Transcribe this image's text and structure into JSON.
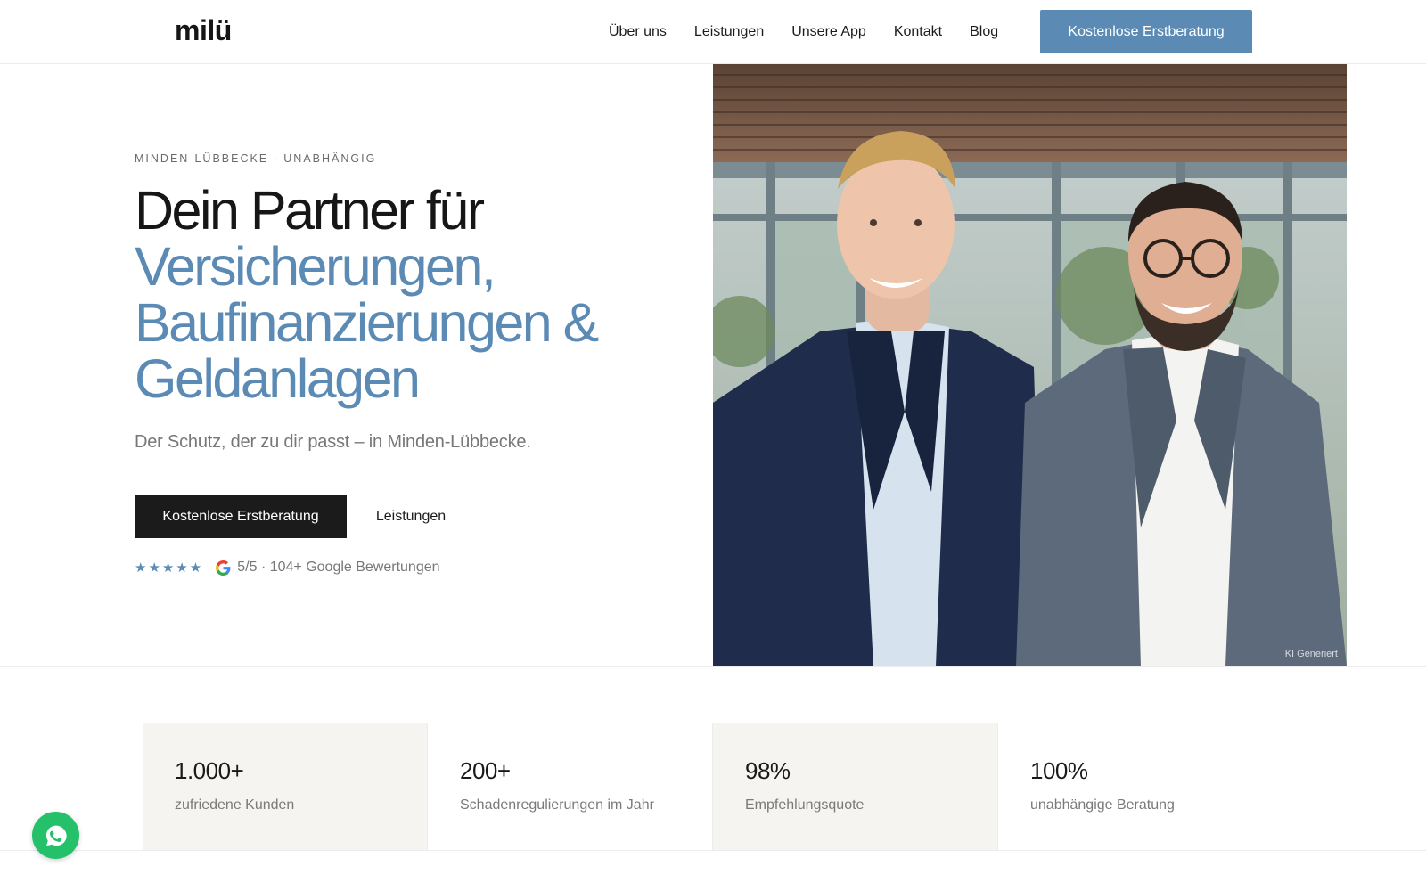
{
  "header": {
    "logo": "milü",
    "nav": [
      {
        "label": "Über uns"
      },
      {
        "label": "Leistungen"
      },
      {
        "label": "Unsere App"
      },
      {
        "label": "Kontakt"
      },
      {
        "label": "Blog"
      }
    ],
    "cta_label": "Kostenlose Erstberatung"
  },
  "hero": {
    "eyebrow": "MINDEN-LÜBBECKE · UNABHÄNGIG",
    "headline_line1": "Dein Partner für",
    "headline_accent": [
      "Versicherungen,",
      "Baufinanzierungen &",
      "Geldanlagen"
    ],
    "subline": "Der Schutz, der zu dir passt – in Minden-Lübbecke.",
    "primary_button": "Kostenlose Erstberatung",
    "secondary_button": "Leistungen",
    "rating": {
      "stars": "★★★★★",
      "text": "5/5 · 104+ Google Bewertungen"
    },
    "image_label": "KI Generiert"
  },
  "stats": [
    {
      "value": "1.000+",
      "label": "zufriedene Kunden"
    },
    {
      "value": "200+",
      "label": "Schadenregulierungen im Jahr"
    },
    {
      "value": "98%",
      "label": "Empfehlungsquote"
    },
    {
      "value": "100%",
      "label": "unabhängige Beratung"
    }
  ],
  "colors": {
    "accent": "#5b8bb5",
    "dark_button": "#1b1b1b",
    "stat_shade": "#f5f4f1",
    "whatsapp": "#25c06a"
  },
  "icons": {
    "google": "google-icon",
    "whatsapp": "whatsapp-icon",
    "star": "star-icon"
  }
}
